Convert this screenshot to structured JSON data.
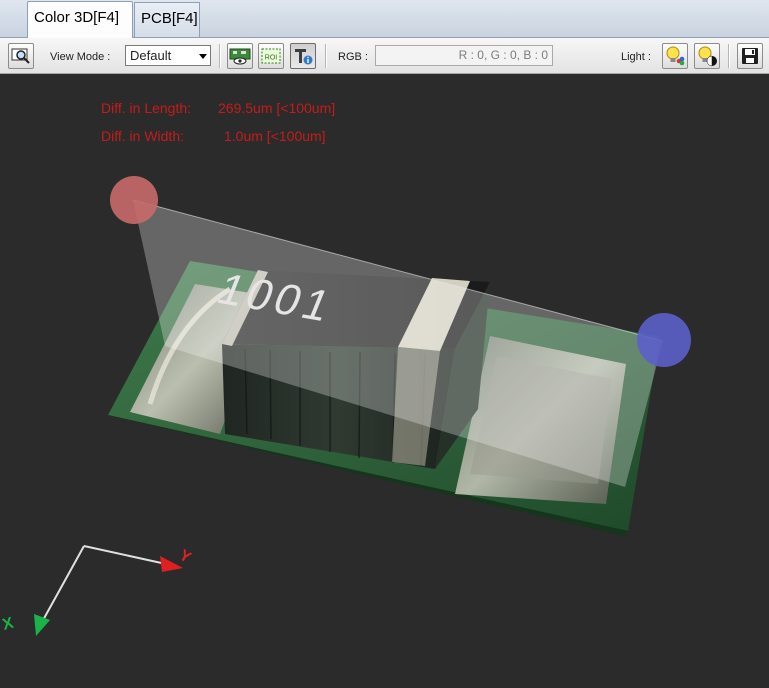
{
  "tabs": [
    {
      "label": "Color 3D[F4]",
      "active": true
    },
    {
      "label": "PCB[F4]",
      "active": false
    }
  ],
  "toolbar": {
    "view_mode_label": "View Mode :",
    "view_mode_value": "Default",
    "roi_label": "ROI",
    "rgb_label": "RGB :",
    "rgb_value": "R : 0, G : 0, B : 0",
    "light_label": "Light :"
  },
  "viewport": {
    "diff_length_label": "Diff. in Length:",
    "diff_length_value": "269.5um [<100um]",
    "diff_width_label": "Diff. in Width:",
    "diff_width_value": "1.0um [<100um]",
    "component_marking": "1001",
    "axis_x_label": "X",
    "axis_y_label": "Y",
    "colors": {
      "text_red": "#c61b1b",
      "marker_left": "#c96a6a",
      "marker_right": "#5b5fc9",
      "background": "#2b2b2b"
    }
  }
}
